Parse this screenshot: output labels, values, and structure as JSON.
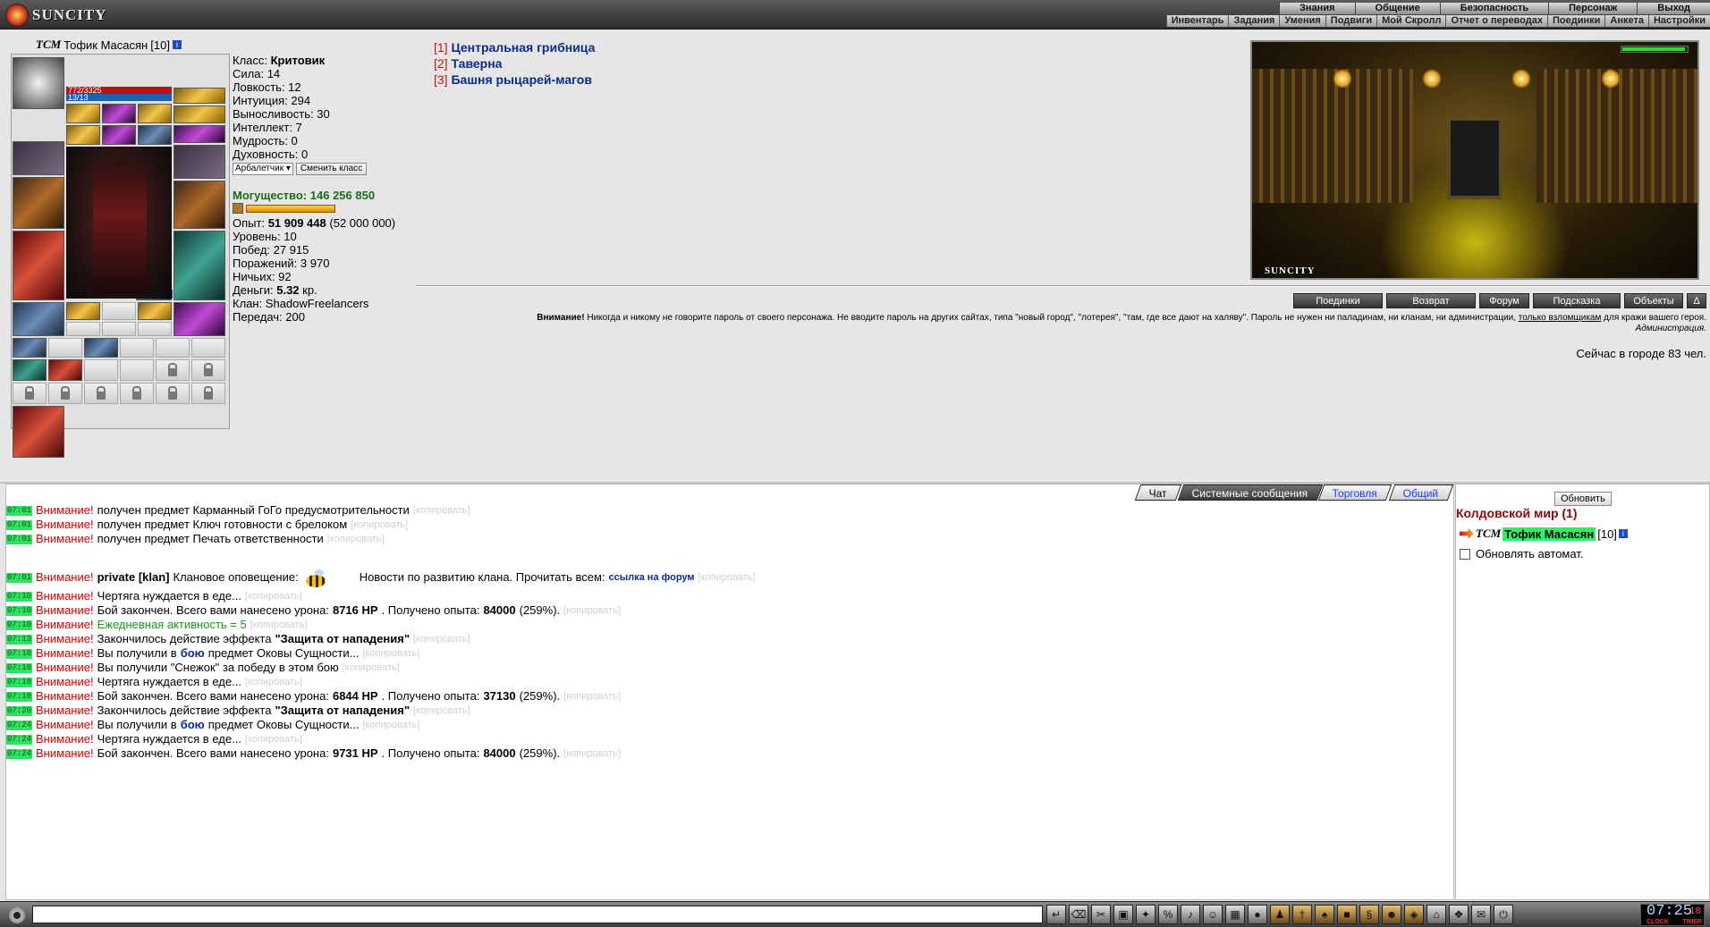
{
  "logo": {
    "text": "SUNCITY"
  },
  "menu_top": [
    "Знания",
    "Общение",
    "Безопасность",
    "Персонаж",
    "Выход"
  ],
  "menu_sub": [
    "Инвентарь",
    "Задания",
    "Умения",
    "Подвиги",
    "Мой Скролл",
    "Отчет о переводах",
    "Поединки",
    "Анкета",
    "Настройки"
  ],
  "character": {
    "clan_mark": "ТСМ",
    "name": "Тофик Масасян",
    "level": "[10]",
    "info_icon": "i",
    "hp": "772/3325",
    "mp": "13/13",
    "slot_counter": "0"
  },
  "stats": {
    "class_label": "Класс:",
    "class_value": "Критовик",
    "lines": [
      "Сила: 14",
      "Ловкость: 12",
      "Интуиция: 294",
      "Выносливость: 30",
      "Интеллект: 7",
      "Мудрость: 0",
      "Духовность: 0"
    ],
    "class_select": "Арбалетчик",
    "change_class_button": "Сменить класс"
  },
  "power": {
    "label": "Могущество:",
    "value": "146 256 850"
  },
  "stats2": {
    "exp_label": "Опыт:",
    "exp_value": "51 909 448",
    "exp_next": "(52 000 000)",
    "lines": [
      "Уровень: 10",
      "Побед: 27 915",
      "Поражений: 3 970",
      "Ничьих: 92"
    ],
    "money_label": "Деньги:",
    "money_value": "5.32",
    "money_unit": "кр.",
    "clan": "Клан: ShadowFreelancers",
    "transfers": "Передач: 200"
  },
  "locations": [
    {
      "num": "[1]",
      "name": "Центральная грибница"
    },
    {
      "num": "[2]",
      "name": "Таверна"
    },
    {
      "num": "[3]",
      "name": "Башня рыцарей-магов"
    }
  ],
  "scene": {
    "label": "SUNCITY"
  },
  "nav_buttons": [
    "Поединки",
    "Возврат",
    "Форум",
    "Подсказка",
    "Объекты",
    "Δ"
  ],
  "warning": {
    "bold": "Внимание!",
    "text": "Никогда и никому не говорите пароль от своего персонажа. Не вводите пароль на других сайтах, типа \"новый город\", \"лотерея\", \"там, где все дают на халяву\". Пароль не нужен ни паладинам, ни кланам, ни администрации,",
    "underlined": "только взломщикам",
    "tail": "для кражи вашего героя.",
    "signature": "Администрация."
  },
  "online": "Сейчас в городе 83 чел.",
  "chat_tabs": [
    "Чат",
    "Системные сообщения",
    "Торговля",
    "Общий"
  ],
  "copy_label": "[копировать]",
  "messages": [
    {
      "time": "07:01",
      "warn": "Внимание!",
      "text": "получен предмет Карманный ГоГо предусмотрительности"
    },
    {
      "time": "07:01",
      "warn": "Внимание!",
      "text": "получен предмет Ключ готовности с брелоком"
    },
    {
      "time": "07:01",
      "warn": "Внимание!",
      "text": "получен предмет Печать ответственности"
    },
    {
      "time": "07:01",
      "warn": "Внимание!",
      "pre_bold": "private [klan]",
      "text": "Клановое оповещение:",
      "after": "Новости по развитию клана. Прочитать всем:",
      "link": "ссылка на форум",
      "clan_notice": true
    },
    {
      "time": "07:10",
      "warn": "Внимание!",
      "text": "Чертяга нуждается в еде..."
    },
    {
      "time": "07:10",
      "warn": "Внимание!",
      "text": "Бой закончен. Всего вами нанесено урона:",
      "b1": "8716 HP",
      "mid": ". Получено опыта:",
      "b2": "84000",
      "end": "(259%)."
    },
    {
      "time": "07:10",
      "warn": "Внимание!",
      "green": "Ежедневная активность = 5"
    },
    {
      "time": "07:13",
      "warn": "Внимание!",
      "text": "Закончилось действие эффекта",
      "quote_bold": "\"Защита от нападения\""
    },
    {
      "time": "07:18",
      "warn": "Внимание!",
      "text": "Вы получили в",
      "bluebold": "бою",
      "tail": "предмет Оковы Сущности..."
    },
    {
      "time": "07:18",
      "warn": "Внимание!",
      "text": "Вы получили \"Снежок\" за победу в этом бою"
    },
    {
      "time": "07:18",
      "warn": "Внимание!",
      "text": "Чертяга нуждается в еде..."
    },
    {
      "time": "07:18",
      "warn": "Внимание!",
      "text": "Бой закончен. Всего вами нанесено урона:",
      "b1": "6844 HP",
      "mid": ". Получено опыта:",
      "b2": "37130",
      "end": "(259%)."
    },
    {
      "time": "07:20",
      "warn": "Внимание!",
      "text": "Закончилось действие эффекта",
      "quote_bold": "\"Защита от нападения\""
    },
    {
      "time": "07:24",
      "warn": "Внимание!",
      "text": "Вы получили в",
      "bluebold": "бою",
      "tail": "предмет Оковы Сущности..."
    },
    {
      "time": "07:24",
      "warn": "Внимание!",
      "text": "Чертяга нуждается в еде..."
    },
    {
      "time": "07:24",
      "warn": "Внимание!",
      "text": "Бой закончен. Всего вами нанесено урона:",
      "b1": "9731 HP",
      "mid": ". Получено опыта:",
      "b2": "84000",
      "end": "(259%)."
    }
  ],
  "side": {
    "refresh_button": "Обновить",
    "world": "Колдовской мир (1)",
    "auto_refresh": "Обновлять автомат."
  },
  "clock": {
    "time": "07:25",
    "seconds": "18",
    "clock_label": "CLOCK",
    "timer_label": "TIMER"
  },
  "toolbar_icons": [
    "enter-icon",
    "eraser-icon",
    "tools-icon",
    "save-icon",
    "fight-icon",
    "stats-icon",
    "music-icon",
    "smile-icon",
    "map-icon",
    "disc-icon",
    "flask-icon",
    "sword-icon",
    "potion-icon",
    "chest-icon",
    "scroll-icon",
    "mask-icon",
    "shield-icon",
    "house-icon",
    "crystal-icon",
    "chat-icon",
    "exit-icon"
  ],
  "colors": {
    "warn": "#e00000",
    "timestamp_bg": "#30e060",
    "location_link": "#0c2c8a",
    "power": "#1a6e1a",
    "world": "#8a0a0a"
  }
}
